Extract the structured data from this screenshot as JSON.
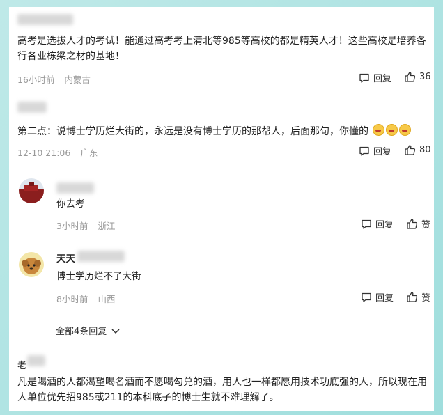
{
  "comments": [
    {
      "text": "高考是选拔人才的考试！能通过高考考上清北等985等高校的都是精英人才！这些高校是培养各行各业栋梁之材的基地！",
      "time": "16小时前",
      "location": "内蒙古",
      "reply_label": "回复",
      "likes": "36"
    },
    {
      "text": "第二点：说博士学历烂大街的，永远是没有博士学历的那帮人，后面那句，你懂的",
      "time": "12-10 21:06",
      "location": "广东",
      "reply_label": "回复",
      "likes": "80",
      "replies": [
        {
          "text": "你去考",
          "time": "3小时前",
          "location": "浙江",
          "reply_label": "回复",
          "like_label": "赞"
        },
        {
          "name": "天天",
          "text": "博士学历烂不了大街",
          "time": "8小时前",
          "location": "山西",
          "reply_label": "回复",
          "like_label": "赞"
        }
      ],
      "more_replies": "全部4条回复"
    },
    {
      "name_prefix": "老",
      "text": "凡是喝酒的人都渴望喝名酒而不愿喝勾兑的酒，用人也一样都愿用技术功底强的人，所以现在用人单位优先招985或211的本科底子的博士生就不难理解了。"
    }
  ],
  "colors": {
    "background": "#a6e0df",
    "meta": "#999999",
    "text": "#222222"
  }
}
